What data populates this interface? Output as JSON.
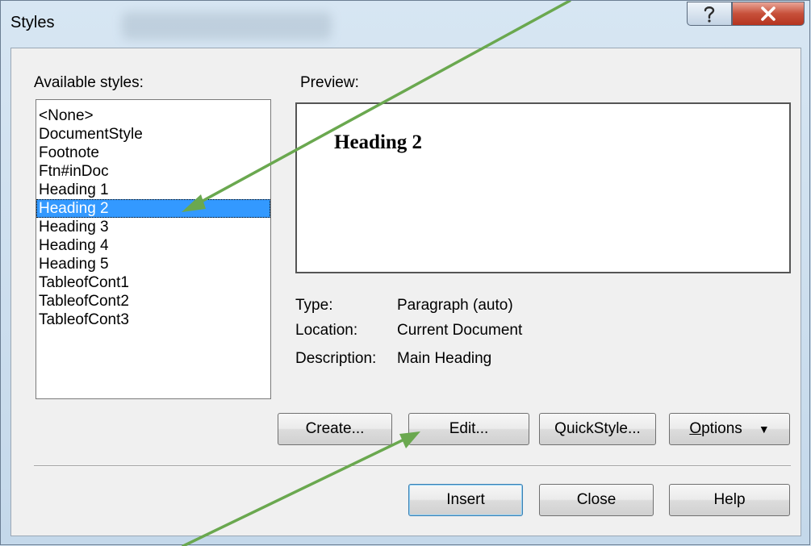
{
  "window": {
    "title": "Styles",
    "help_icon": "question-mark-icon",
    "close_icon": "close-x-icon"
  },
  "left": {
    "label": "Available styles:",
    "items": [
      {
        "label": "<None>"
      },
      {
        "label": "DocumentStyle"
      },
      {
        "label": "Footnote"
      },
      {
        "label": "Ftn#inDoc"
      },
      {
        "label": "Heading 1"
      },
      {
        "label": "Heading 2",
        "selected": true
      },
      {
        "label": "Heading 3"
      },
      {
        "label": "Heading 4"
      },
      {
        "label": "Heading 5"
      },
      {
        "label": "TableofCont1"
      },
      {
        "label": "TableofCont2"
      },
      {
        "label": "TableofCont3"
      }
    ]
  },
  "preview": {
    "label": "Preview:",
    "text": "Heading 2"
  },
  "info": {
    "type_label": "Type:",
    "type_value": "Paragraph (auto)",
    "location_label": "Location:",
    "location_value": "Current Document",
    "description_label": "Description:",
    "description_value": "Main Heading"
  },
  "buttons": {
    "create": "Create...",
    "edit": "Edit...",
    "quickstyle": "QuickStyle...",
    "options_mnemonic": "O",
    "options_rest": "ptions",
    "insert": "Insert",
    "close": "Close",
    "help": "Help"
  },
  "colors": {
    "selection": "#3399ff",
    "annotation_arrow": "#6aa84f",
    "close_button": "#c7503a"
  }
}
